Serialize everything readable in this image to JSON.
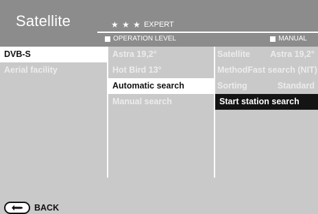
{
  "header": {
    "title": "Satellite",
    "stars": "★ ★ ★",
    "level_label": "EXPERT",
    "operation_level_label": "OPERATION LEVEL",
    "manual_label": "MANUAL"
  },
  "menu": {
    "items": [
      {
        "label": "DVB-S",
        "state": "selected"
      },
      {
        "label": "Aerial facility",
        "state": "normal"
      }
    ]
  },
  "submenu": {
    "items": [
      {
        "label": "Astra 19,2°",
        "state": "normal"
      },
      {
        "label": "Hot Bird 13°",
        "state": "normal"
      },
      {
        "label": "Automatic search",
        "state": "selected"
      },
      {
        "label": "Manual search",
        "state": "normal"
      }
    ]
  },
  "details": {
    "rows": [
      {
        "label": "Satellite",
        "value": "Astra 19,2°"
      },
      {
        "label": "Method",
        "value": "Fast search (NIT)"
      },
      {
        "label": "Sorting",
        "value": "Standard"
      }
    ],
    "action": "Start station search"
  },
  "footer": {
    "back_label": "BACK",
    "back_icon": "back-arrow-icon"
  }
}
